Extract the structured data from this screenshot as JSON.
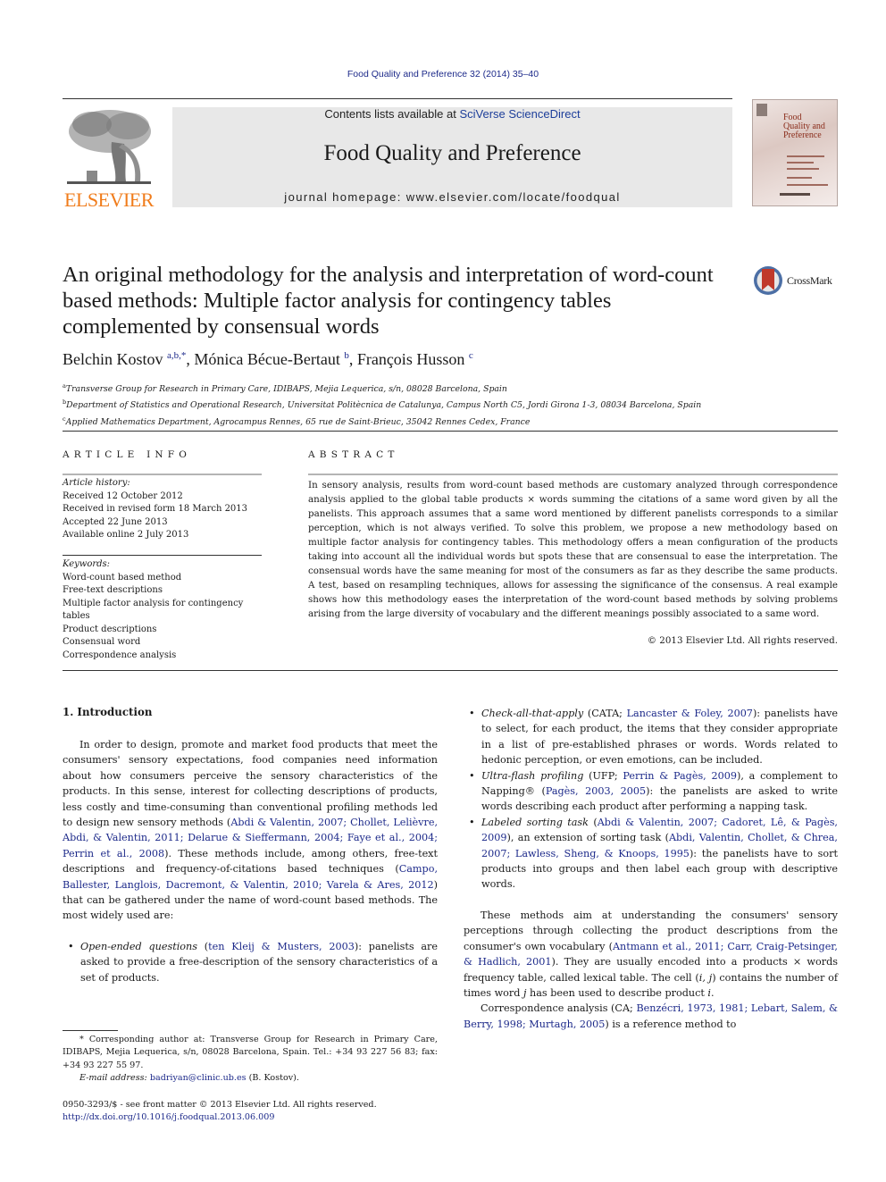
{
  "header": {
    "journal_ref": "Food Quality and Preference 32 (2014) 35–40",
    "contents_prefix": "Contents lists available at ",
    "contents_link": "SciVerse ScienceDirect",
    "journal_title": "Food Quality and Preference",
    "homepage_line": "journal homepage: www.elsevier.com/locate/foodqual",
    "publisher_logo": "ELSEVIER",
    "cover": {
      "title_lines": [
        "Food",
        "Quality and",
        "Preference"
      ]
    },
    "crossmark_label": "CrossMark",
    "colors": {
      "link": "#1d2a8a",
      "elsevier_orange": "#f07c1b",
      "banner_grey": "#e8e8e8",
      "crossmark_red": "#c0392b"
    }
  },
  "article": {
    "title": "An original methodology for the analysis and interpretation of word-count based methods: Multiple factor analysis for contingency tables complemented by consensual words",
    "authors": [
      {
        "name": "Belchin Kostov",
        "sup": "a,b,*"
      },
      {
        "name": "Mónica Bécue-Bertaut",
        "sup": "b"
      },
      {
        "name": "François Husson",
        "sup": "c"
      }
    ],
    "affiliations": [
      {
        "key": "a",
        "text": "Transverse Group for Research in Primary Care, IDIBAPS, Mejia Lequerica, s/n, 08028 Barcelona, Spain"
      },
      {
        "key": "b",
        "text": "Department of Statistics and Operational Research, Universitat Politècnica de Catalunya, Campus North C5, Jordi Girona 1-3, 08034 Barcelona, Spain"
      },
      {
        "key": "c",
        "text": "Applied Mathematics Department, Agrocampus Rennes, 65 rue de Saint-Brieuc, 35042 Rennes Cedex, France"
      }
    ]
  },
  "article_info": {
    "heading": "ARTICLE INFO",
    "history_label": "Article history:",
    "history": [
      "Received 12 October 2012",
      "Received in revised form 18 March 2013",
      "Accepted 22 June 2013",
      "Available online 2 July 2013"
    ],
    "keywords_label": "Keywords:",
    "keywords": [
      "Word-count based method",
      "Free-text descriptions",
      "Multiple factor analysis for contingency tables",
      "Product descriptions",
      "Consensual word",
      "Correspondence analysis"
    ]
  },
  "abstract": {
    "heading": "ABSTRACT",
    "text": "In sensory analysis, results from word-count based methods are customary analyzed through correspondence analysis applied to the global table products × words summing the citations of a same word given by all the panelists. This approach assumes that a same word mentioned by different panelists corresponds to a similar perception, which is not always verified. To solve this problem, we propose a new methodology based on multiple factor analysis for contingency tables. This methodology offers a mean configuration of the products taking into account all the individual words but spots these that are consensual to ease the interpretation. The consensual words have the same meaning for most of the consumers as far as they describe the same products. A test, based on resampling techniques, allows for assessing the significance of the consensus. A real example shows how this methodology eases the interpretation of the word-count based methods by solving problems arising from the large diversity of vocabulary and the different meanings possibly associated to a same word.",
    "copyright": "© 2013 Elsevier Ltd. All rights reserved."
  },
  "body": {
    "intro_heading": "1. Introduction",
    "intro_p1": [
      {
        "t": "In order to design, promote and market food products that meet the consumers' sensory expectations, food companies need information about how consumers perceive the sensory characteristics of the products. In this sense, interest for collecting descriptions of products, less costly and time-consuming than conventional profiling methods led to design new sensory methods ("
      },
      {
        "t": "Abdi & Valentin, 2007; Chollet, Lelièvre, Abdi, & Valentin, 2011; Delarue & Sieffermann, 2004; Faye et al., 2004; Perrin et al., 2008",
        "link": true
      },
      {
        "t": "). These methods include, among others, free-text descriptions and frequency-of-citations based techniques ("
      },
      {
        "t": "Campo, Ballester, Langlois, Dacremont, & Valentin, 2010; Varela & Ares, 2012",
        "link": true
      },
      {
        "t": ") that can be gathered under the name of word-count based methods. The most widely used are:"
      }
    ],
    "bullets": [
      {
        "term": "Open-ended questions",
        "parts": [
          {
            "t": " ("
          },
          {
            "t": "ten Kleij & Musters, 2003",
            "link": true
          },
          {
            "t": "): panelists are asked to provide a free-description of the sensory characteristics of a set of products."
          }
        ]
      },
      {
        "term": "Check-all-that-apply",
        "parts": [
          {
            "t": " (CATA; "
          },
          {
            "t": "Lancaster & Foley, 2007",
            "link": true
          },
          {
            "t": "): panelists have to select, for each product, the items that they consider appropriate in a list of pre-established phrases or words. Words related to hedonic perception, or even emotions, can be included."
          }
        ]
      },
      {
        "term": "Ultra-flash profiling",
        "parts": [
          {
            "t": " (UFP; "
          },
          {
            "t": "Perrin & Pagès, 2009",
            "link": true
          },
          {
            "t": "), a complement to Napping® ("
          },
          {
            "t": "Pagès, 2003, 2005",
            "link": true
          },
          {
            "t": "): the panelists are asked to write words describing each product after performing a napping task."
          }
        ]
      },
      {
        "term": "Labeled sorting task",
        "parts": [
          {
            "t": " ("
          },
          {
            "t": "Abdi & Valentin, 2007; Cadoret, Lê, & Pagès, 2009",
            "link": true
          },
          {
            "t": "), an extension of sorting task ("
          },
          {
            "t": "Abdi, Valentin, Chollet, & Chrea, 2007; Lawless, Sheng, & Knoops, 1995",
            "link": true
          },
          {
            "t": "): the panelists have to sort products into groups and then label each group with descriptive words."
          }
        ]
      }
    ],
    "para2": [
      {
        "t": "These methods aim at understanding the consumers' sensory perceptions through collecting the product descriptions from the consumer's own vocabulary ("
      },
      {
        "t": "Antmann et al., 2011; Carr, Craig-Petsinger, & Hadlich, 2001",
        "link": true
      },
      {
        "t": "). They are usually encoded into a products × words frequency table, called lexical table. The cell ("
      },
      {
        "t": "i, j",
        "em": true
      },
      {
        "t": ") contains the number of times word "
      },
      {
        "t": "j",
        "em": true
      },
      {
        "t": " has been used to describe product "
      },
      {
        "t": "i",
        "em": true
      },
      {
        "t": "."
      }
    ],
    "para3": [
      {
        "t": "Correspondence analysis (CA; "
      },
      {
        "t": "Benzécri, 1973, 1981; Lebart, Salem, & Berry, 1998; Murtagh, 2005",
        "link": true
      },
      {
        "t": ") is a reference method to"
      }
    ]
  },
  "footnote": {
    "corresponding": "* Corresponding author at: Transverse Group for Research in Primary Care, IDIBAPS, Mejia Lequerica, s/n, 08028 Barcelona, Spain. Tel.: +34 93 227 56 83; fax: +34 93 227 55 97.",
    "email_label": "E-mail address: ",
    "email": "badriyan@clinic.ub.es",
    "email_suffix": " (B. Kostov).",
    "issn_line": "0950-3293/$ - see front matter © 2013 Elsevier Ltd. All rights reserved.",
    "doi": "http://dx.doi.org/10.1016/j.foodqual.2013.06.009"
  }
}
